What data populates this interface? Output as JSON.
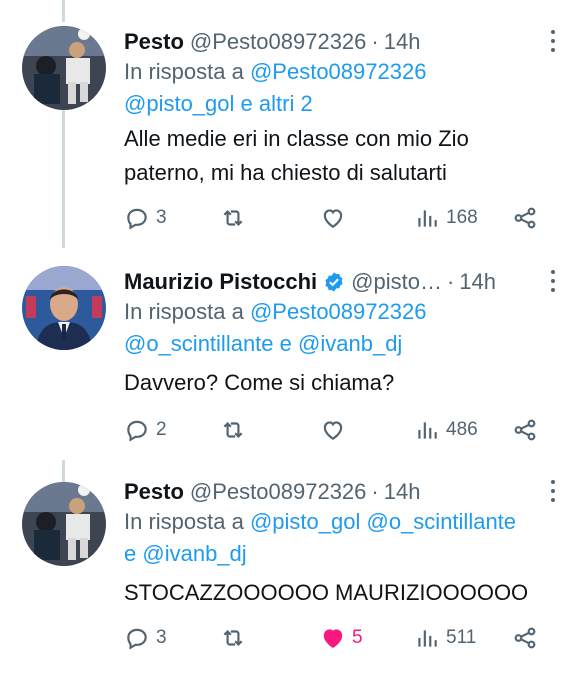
{
  "colors": {
    "accent": "#1d9bf0",
    "secondary_text": "#536471",
    "like": "#f91880",
    "verified": "#1d9bf0"
  },
  "tweets": [
    {
      "name": "Pesto",
      "handle": "@Pesto08972326",
      "dot": "·",
      "time": "14h",
      "reply_prefix": "In risposta a",
      "reply_line1_mentions": [
        "@Pesto08972326"
      ],
      "reply_line2": [
        "@pisto_gol",
        "e",
        "altri 2"
      ],
      "text": "Alle medie eri in classe con mio Zio\npaterno, mi ha chiesto di salutarti",
      "replies": "3",
      "retweets": "",
      "likes": "",
      "views": "168",
      "liked": false,
      "avatar_icon": "football-player-avatar"
    },
    {
      "name": "Maurizio Pistocchi",
      "handle": "@pisto…",
      "dot": "·",
      "time": "14h",
      "verified": true,
      "reply_prefix": "In risposta a",
      "reply_line1_mentions": [
        "@Pesto08972326"
      ],
      "reply_line2": [
        "@o_scintillante",
        "e",
        "@ivanb_dj"
      ],
      "text": "Davvero? Come si chiama?",
      "replies": "2",
      "retweets": "",
      "likes": "",
      "views": "486",
      "liked": false,
      "avatar_icon": "man-in-suit-avatar"
    },
    {
      "name": "Pesto",
      "handle": "@Pesto08972326",
      "dot": "·",
      "time": "14h",
      "reply_prefix": "In risposta a",
      "reply_line1_mentions": [
        "@pisto_gol",
        "@o_scintillante"
      ],
      "reply_line2": [
        "e",
        "@ivanb_dj"
      ],
      "text": "STOCAZZOOOOOO MAURIZIOOOOOO",
      "replies": "3",
      "retweets": "",
      "likes": "5",
      "views": "511",
      "liked": true,
      "avatar_icon": "football-player-avatar"
    }
  ]
}
